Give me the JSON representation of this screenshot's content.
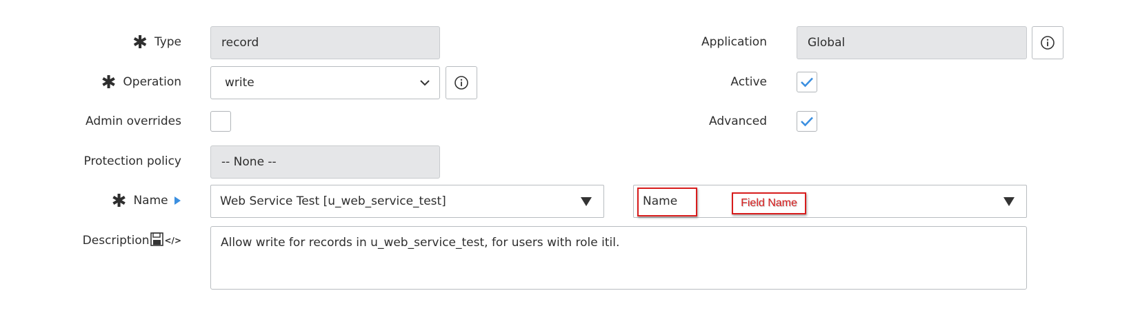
{
  "form": {
    "type": {
      "label": "Type",
      "value": "record"
    },
    "operation": {
      "label": "Operation",
      "value": "write"
    },
    "admin_overrides": {
      "label": "Admin overrides",
      "checked": false
    },
    "protection_policy": {
      "label": "Protection policy",
      "value": "-- None --"
    },
    "name": {
      "label": "Name",
      "table_value": "Web Service Test [u_web_service_test]",
      "field_value": "Name"
    },
    "description": {
      "label": "Description",
      "code_toggle": "</>",
      "value": "Allow write for records in u_web_service_test, for users with role itil."
    },
    "application": {
      "label": "Application",
      "value": "Global"
    },
    "active": {
      "label": "Active",
      "checked": true
    },
    "advanced": {
      "label": "Advanced",
      "checked": true
    }
  },
  "annotations": {
    "field_name_label": "Field Name"
  },
  "colors": {
    "check_blue": "#3b8fe0",
    "annotation_red": "#d81c1c",
    "readonly_bg": "#e5e6e8"
  }
}
